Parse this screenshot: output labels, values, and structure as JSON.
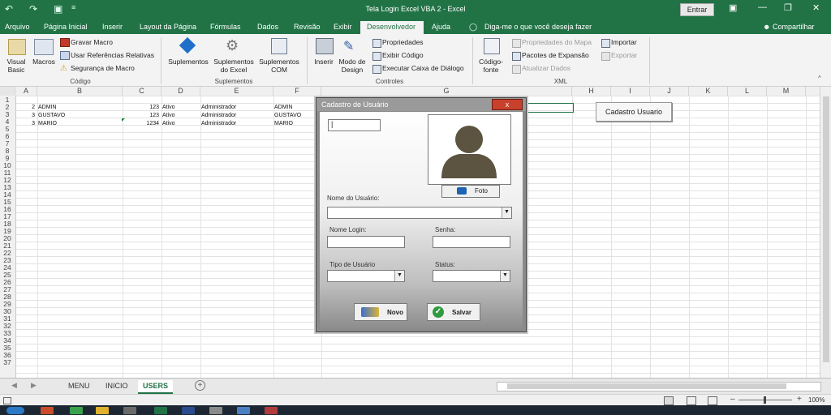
{
  "window": {
    "title": "Tela Login Excel VBA 2  -  Excel",
    "signin": "Entrar"
  },
  "ribbon_tabs": [
    "Arquivo",
    "Página Inicial",
    "Inserir",
    "Layout da Página",
    "Fórmulas",
    "Dados",
    "Revisão",
    "Exibir",
    "Desenvolvedor",
    "Ajuda"
  ],
  "tell_me": "Diga-me o que você deseja fazer",
  "share": "Compartilhar",
  "ribbon": {
    "codigo": {
      "visual_basic": "Visual Basic",
      "macros": "Macros",
      "gravar": "Gravar Macro",
      "referencias": "Usar Referências Relativas",
      "seguranca": "Segurança de Macro",
      "label": "Código"
    },
    "suplementos": {
      "suplementos": "Suplementos",
      "excel": "Suplementos do Excel",
      "com": "Suplementos COM",
      "label": "Suplementos"
    },
    "controles": {
      "inserir": "Inserir",
      "design": "Modo de Design",
      "propriedades": "Propriedades",
      "exibir_codigo": "Exibir Código",
      "executar": "Executar Caixa de Diálogo",
      "label": "Controles"
    },
    "xml": {
      "codigo_fonte": "Código-fonte",
      "propriedades_mapa": "Propriedades do Mapa",
      "pacotes": "Pacotes de Expansão",
      "atualizar": "Atualizar Dados",
      "importar": "Importar",
      "exportar": "Exportar",
      "label": "XML"
    }
  },
  "columns": [
    "A",
    "B",
    "C",
    "D",
    "E",
    "F",
    "G",
    "H",
    "I",
    "J",
    "K",
    "L",
    "M"
  ],
  "rows": [
    "1",
    "2",
    "3",
    "4",
    "5",
    "6",
    "7",
    "8",
    "9",
    "10",
    "11",
    "12",
    "13",
    "14",
    "15",
    "16",
    "17",
    "18",
    "19",
    "20",
    "21",
    "22",
    "23",
    "24",
    "25",
    "26",
    "27",
    "28",
    "29",
    "30",
    "31",
    "32",
    "33",
    "34",
    "35",
    "36",
    "37"
  ],
  "data_rows": [
    {
      "id": "2",
      "name": "ADMIN",
      "code": "123",
      "status": "Ativo",
      "type": "Administrador",
      "login": "ADMIN"
    },
    {
      "id": "3",
      "name": "GUSTAVO",
      "code": "123",
      "status": "Ativo",
      "type": "Administrador",
      "login": "GUSTAVO"
    },
    {
      "id": "3",
      "name": "MARIO",
      "code": "1234",
      "status": "Ativo",
      "type": "Administrador",
      "login": "MARIO"
    }
  ],
  "sheet_button": "Cadastro Usuario",
  "form": {
    "title": "Cadastro de Usuário",
    "close": "x",
    "foto_button": "Foto",
    "nome_usuario_label": "Nome do Usuário:",
    "nome_login_label": "Nome Login:",
    "senha_label": "Senha:",
    "tipo_label": "Tipo de Usuário",
    "status_label": "Status:",
    "novo_button": "Novo",
    "salvar_button": "Salvar"
  },
  "sheets": [
    "MENU",
    "INICIO",
    "USERS"
  ],
  "zoom": "100%"
}
